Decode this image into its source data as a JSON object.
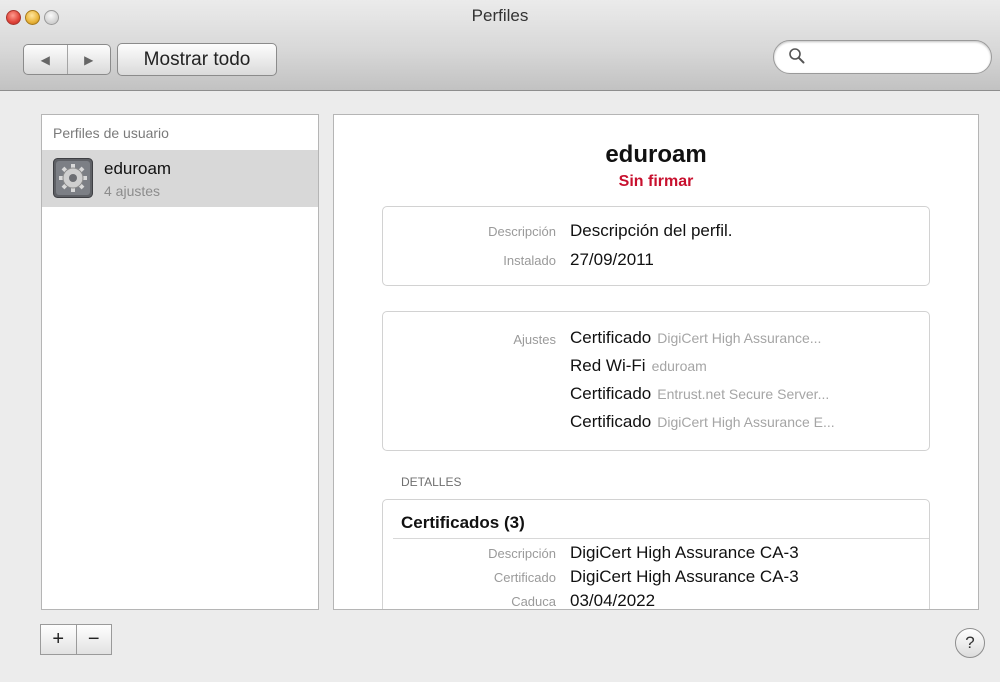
{
  "window": {
    "title": "Perfiles"
  },
  "toolbar": {
    "back_icon": "◀",
    "forward_icon": "▶",
    "show_all_label": "Mostrar todo",
    "search_placeholder": ""
  },
  "sidebar": {
    "header": "Perfiles de usuario",
    "items": [
      {
        "name": "eduroam",
        "count": "4 ajustes",
        "icon": "settings-gear-icon"
      }
    ]
  },
  "profile": {
    "name": "eduroam",
    "status": "Sin firmar",
    "status_color": "#c8102e",
    "description_label": "Descripción",
    "description_value": "Descripción del perfil.",
    "installed_label": "Instalado",
    "installed_value": "27/09/2011",
    "settings_label": "Ajustes",
    "settings": [
      {
        "type": "Certificado",
        "detail": "DigiCert High Assurance..."
      },
      {
        "type": "Red Wi-Fi",
        "detail": "eduroam"
      },
      {
        "type": "Certificado",
        "detail": "Entrust.net Secure Server..."
      },
      {
        "type": "Certificado",
        "detail": "DigiCert High Assurance E..."
      }
    ],
    "details_header": "DETALLES",
    "certificates": {
      "header": "Certificados (3)",
      "rows": [
        {
          "label": "Descripción",
          "value": "DigiCert High Assurance CA-3"
        },
        {
          "label": "Certificado",
          "value": "DigiCert High Assurance CA-3"
        },
        {
          "label": "Caduca",
          "value": "03/04/2022"
        }
      ]
    }
  },
  "bottom": {
    "add_label": "+",
    "remove_label": "−",
    "help_label": "?"
  }
}
